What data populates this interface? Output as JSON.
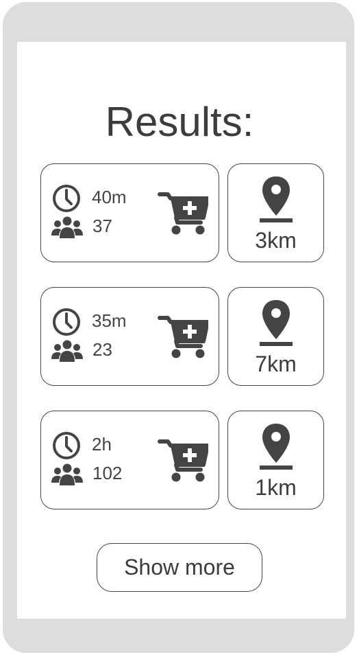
{
  "page": {
    "title": "Results:"
  },
  "results": [
    {
      "time": "40m",
      "people": "37",
      "distance": "3km"
    },
    {
      "time": "35m",
      "people": "23",
      "distance": "7km"
    },
    {
      "time": "2h",
      "people": "102",
      "distance": "1km"
    }
  ],
  "footer": {
    "show_more_label": "Show more"
  },
  "icons": {
    "time": "clock-icon",
    "people": "people-group-icon",
    "add": "cart-plus-icon",
    "distance": "location-pin-icon"
  },
  "colors": {
    "device_frame": "#dddddd",
    "icon": "#444444",
    "text": "#3c3c3c"
  }
}
